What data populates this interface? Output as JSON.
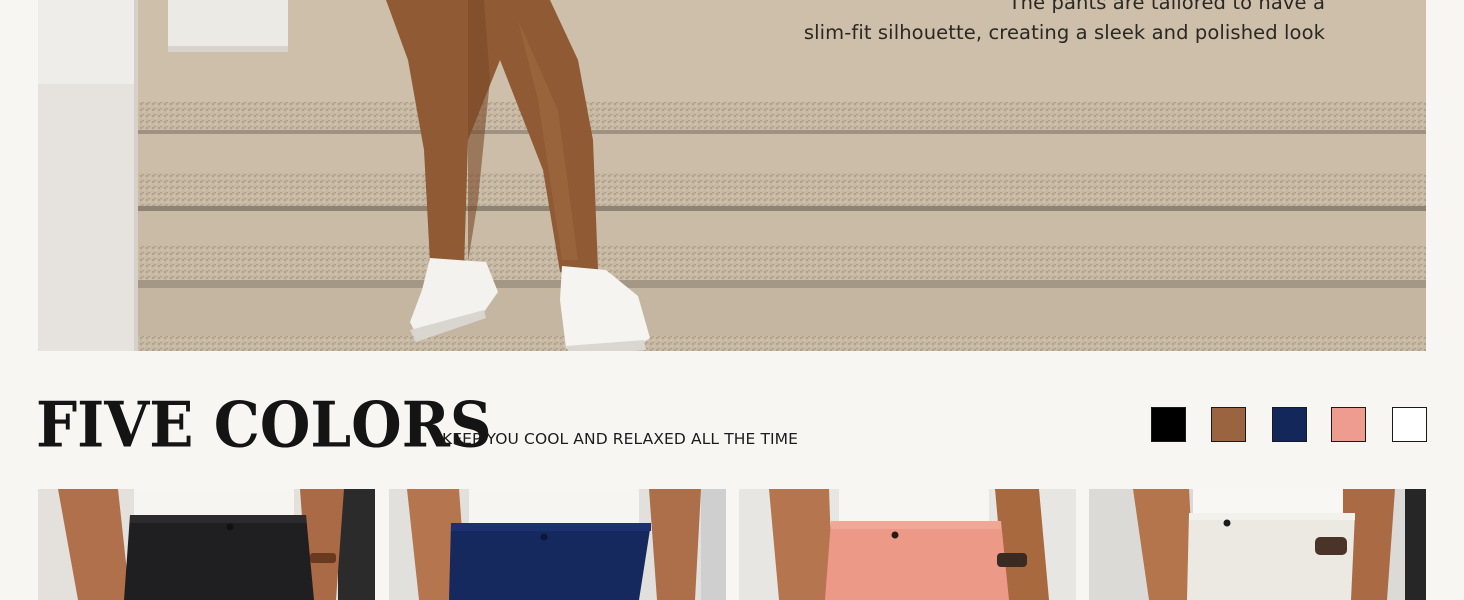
{
  "hero": {
    "caption_line1": "The pants are tailored to have a",
    "caption_line2": "slim-fit silhouette, creating a sleek and polished look"
  },
  "colors_section": {
    "title": "FIVE COLORS",
    "subtitle": "KEEP YOU COOL AND RELAXED ALL THE TIME",
    "swatches": [
      {
        "name": "black",
        "color": "#000000"
      },
      {
        "name": "brown",
        "color": "#9a6440"
      },
      {
        "name": "navy",
        "color": "#14275a"
      },
      {
        "name": "pink",
        "color": "#ef9c90"
      },
      {
        "name": "white",
        "color": "#ffffff"
      }
    ]
  },
  "products": [
    {
      "name": "black pants",
      "pant_color": "#1f1f21"
    },
    {
      "name": "navy pants",
      "pant_color": "#16295e"
    },
    {
      "name": "pink pants",
      "pant_color": "#ec9987"
    },
    {
      "name": "white pants",
      "pant_color": "#ece9e3"
    }
  ]
}
